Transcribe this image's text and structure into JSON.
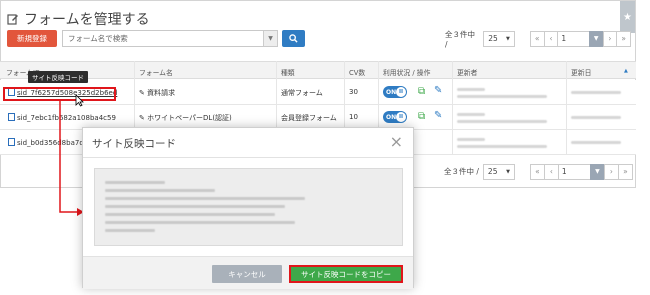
{
  "page": {
    "title": "フォームを管理する",
    "new_button": "新規登録",
    "search_placeholder": "フォーム名で検索",
    "star_icon": "★"
  },
  "pager": {
    "count": "全３件中 /",
    "per_page": "25",
    "page": "1",
    "first": "«",
    "prev": "‹",
    "next": "›",
    "last": "»"
  },
  "table": {
    "headers": [
      "フォームID",
      "フォーム名",
      "種類",
      "CV数",
      "利用状況 / 操作",
      "更新者",
      "更新日"
    ],
    "sort_icon": "▲",
    "rows": [
      {
        "id": "sid_7f6257d508e325d2b6ed",
        "name": "資料請求",
        "type": "通常フォーム",
        "cv": "30",
        "status": "ON"
      },
      {
        "id": "sid_7ebc1fb682a108ba4c59",
        "name": "ホワイトペーパーDL(認証)",
        "type": "会員登録フォーム",
        "cv": "10",
        "status": "ON"
      },
      {
        "id": "sid_b0d356d8ba7d",
        "name": "",
        "type": "",
        "cv": "",
        "status": ""
      }
    ]
  },
  "tooltip": "サイト反映コード",
  "modal": {
    "title": "サイト反映コード",
    "close": "×",
    "cancel": "キャンセル",
    "copy": "サイト反映コードをコピー"
  },
  "colors": {
    "accent_red": "#e2563c",
    "primary_blue": "#2f7cc3",
    "green": "#3ea84a",
    "highlight": "#e0161b"
  }
}
